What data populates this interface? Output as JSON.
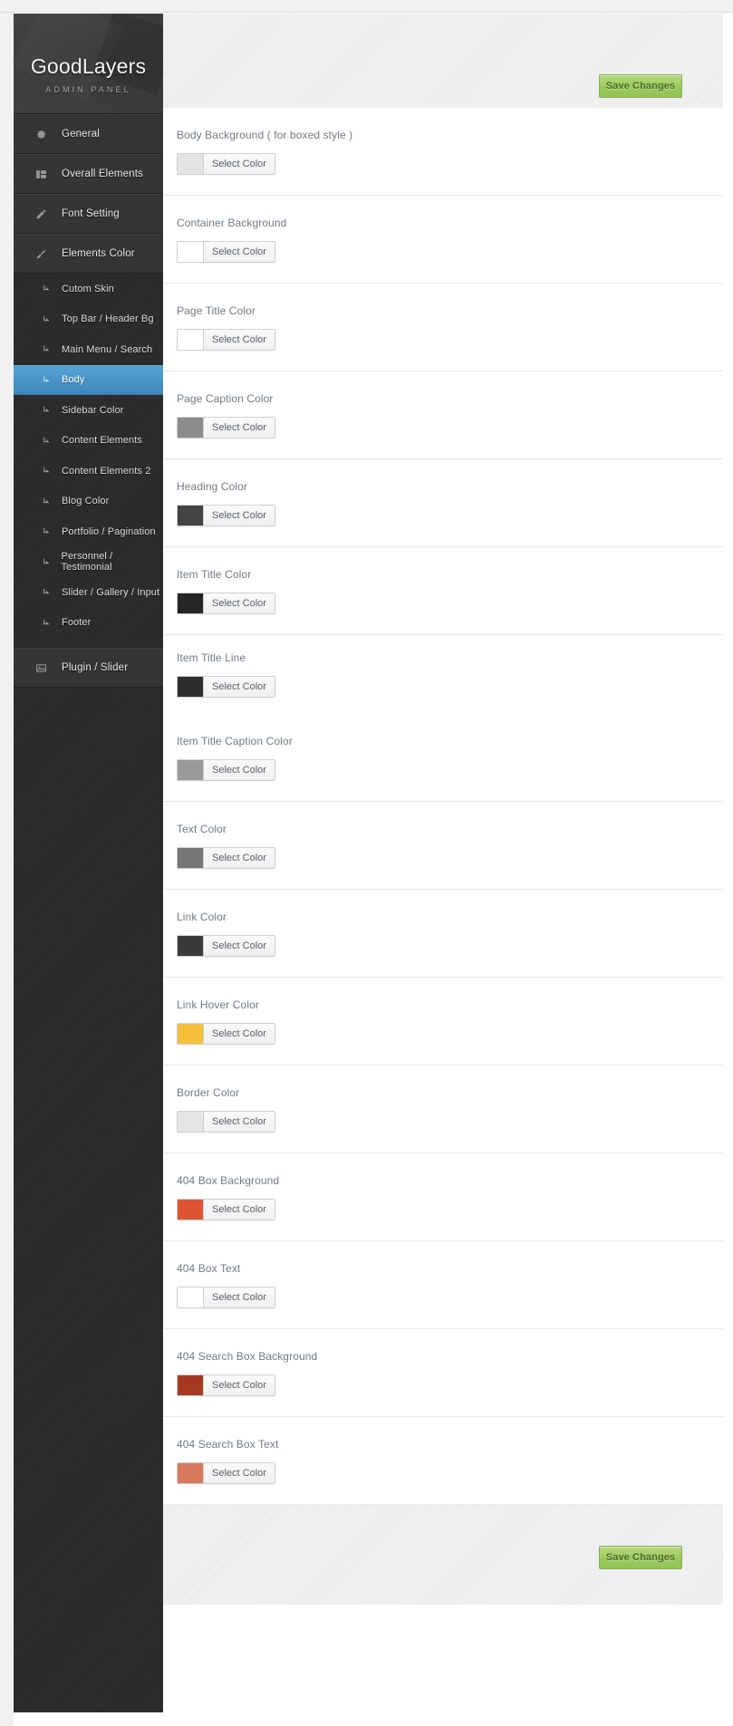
{
  "brand": {
    "title": "GoodLayers",
    "subtitle": "ADMIN PANEL"
  },
  "toolbar": {
    "save_label": "Save Changes",
    "save_label_bottom": "Save Changes",
    "accent_green": "#9cc95e"
  },
  "sidebar": {
    "top_items": [
      {
        "label": "General",
        "icon": "gear-icon"
      },
      {
        "label": "Overall Elements",
        "icon": "columns-icon"
      },
      {
        "label": "Font Setting",
        "icon": "pencil-icon"
      },
      {
        "label": "Elements Color",
        "icon": "brush-icon"
      }
    ],
    "sub_items": [
      {
        "label": "Cutom Skin",
        "icon": "arrow-down-right-icon",
        "active": false
      },
      {
        "label": "Top Bar / Header Bg",
        "icon": "arrow-down-right-icon",
        "active": false
      },
      {
        "label": "Main Menu / Search",
        "icon": "arrow-down-right-icon",
        "active": false
      },
      {
        "label": "Body",
        "icon": "arrow-down-right-icon",
        "active": true
      },
      {
        "label": "Sidebar Color",
        "icon": "arrow-down-right-icon",
        "active": false
      },
      {
        "label": "Content Elements",
        "icon": "arrow-down-right-icon",
        "active": false
      },
      {
        "label": "Content Elements 2",
        "icon": "arrow-down-right-icon",
        "active": false
      },
      {
        "label": "Blog Color",
        "icon": "arrow-down-right-icon",
        "active": false
      },
      {
        "label": "Portfolio / Pagination",
        "icon": "arrow-down-right-icon",
        "active": false
      },
      {
        "label": "Personnel / Testimonial",
        "icon": "arrow-down-right-icon",
        "active": false
      },
      {
        "label": "Slider / Gallery / Input",
        "icon": "arrow-down-right-icon",
        "active": false
      },
      {
        "label": "Footer",
        "icon": "arrow-down-right-icon",
        "active": false
      }
    ],
    "bottom_items": [
      {
        "label": "Plugin / Slider",
        "icon": "image-icon"
      }
    ],
    "active_highlight": "#4a96c8"
  },
  "main": {
    "picker_button_label": "Select Color",
    "fields": [
      {
        "label": "Body Background ( for boxed style )",
        "swatch": "#e4e4e4"
      },
      {
        "label": "Container Background",
        "swatch": "#ffffff"
      },
      {
        "label": "Page Title Color",
        "swatch": "#ffffff"
      },
      {
        "label": "Page Caption Color",
        "swatch": "#8c8c8c"
      },
      {
        "label": "Heading Color",
        "swatch": "#444444"
      },
      {
        "label": "Item Title Color",
        "swatch": "#262626"
      },
      {
        "label": "Item Title Line",
        "swatch": "#2e2e2e"
      },
      {
        "label": "Item Title Caption Color",
        "swatch": "#9a9a9a"
      },
      {
        "label": "Text Color",
        "swatch": "#777777"
      },
      {
        "label": "Link Color",
        "swatch": "#3a3a3a"
      },
      {
        "label": "Link Hover Color",
        "swatch": "#f5c13c"
      },
      {
        "label": "Border Color",
        "swatch": "#e5e5e5"
      },
      {
        "label": "404 Box Background",
        "swatch": "#dd5533"
      },
      {
        "label": "404 Box Text",
        "swatch": "#ffffff"
      },
      {
        "label": "404 Search Box Background",
        "swatch": "#a63a20"
      },
      {
        "label": "404 Search Box Text",
        "swatch": "#d9775a"
      }
    ]
  }
}
